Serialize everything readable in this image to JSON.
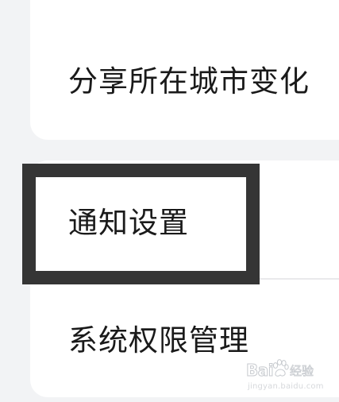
{
  "settings": {
    "items": [
      {
        "label": "分享所在城市变化"
      },
      {
        "label": "通知设置"
      },
      {
        "label": "系统权限管理"
      }
    ]
  },
  "highlight": {
    "color": "#353535"
  },
  "watermark": {
    "brand": "Bai",
    "paw_icon": "paw-icon",
    "sub": "经验",
    "url": "jingyan.baidu.com"
  },
  "colors": {
    "background": "#f2f3f5",
    "card": "#ffffff",
    "divider": "#e9e9ec",
    "text": "#1a1a1a"
  }
}
